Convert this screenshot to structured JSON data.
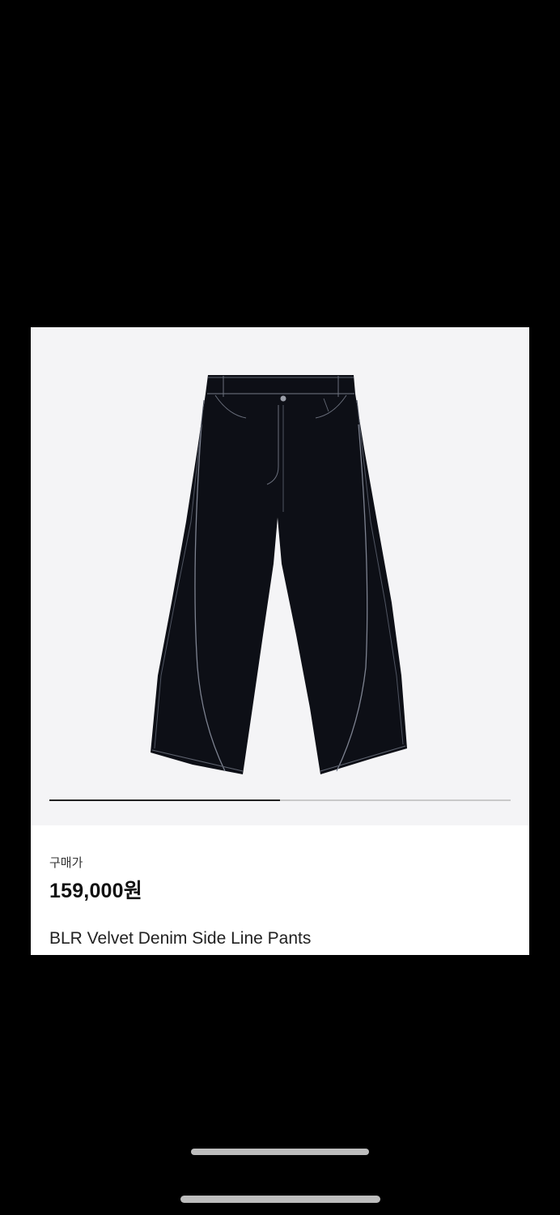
{
  "product": {
    "image_alt": "black wide denim pants",
    "price_label": "구매가",
    "price": "159,000원",
    "name": "BLR Velvet Denim Side Line Pants"
  },
  "carousel": {
    "progress_fraction": 0.5
  },
  "colors": {
    "page_background": "#000000",
    "card_background": "#ffffff",
    "image_background": "#f4f4f6",
    "pants": "#0d0f16",
    "stitching": "#8a8f9c",
    "progress_track": "#c9c9c9",
    "progress_fill": "#222222"
  }
}
